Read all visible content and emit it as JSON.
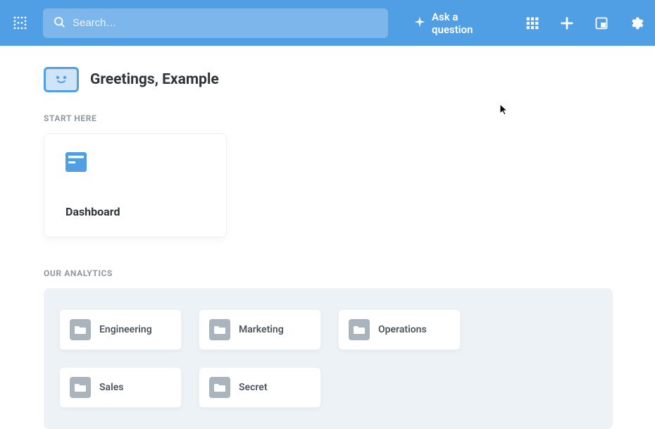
{
  "nav": {
    "search_placeholder": "Search…",
    "ask_label": "Ask a question"
  },
  "greeting": {
    "text": "Greetings, Example"
  },
  "start_here": {
    "label": "START HERE",
    "card_title": "Dashboard"
  },
  "analytics": {
    "label": "OUR ANALYTICS",
    "collections": [
      {
        "name": "Engineering"
      },
      {
        "name": "Marketing"
      },
      {
        "name": "Operations"
      },
      {
        "name": "Sales"
      },
      {
        "name": "Secret"
      }
    ]
  }
}
